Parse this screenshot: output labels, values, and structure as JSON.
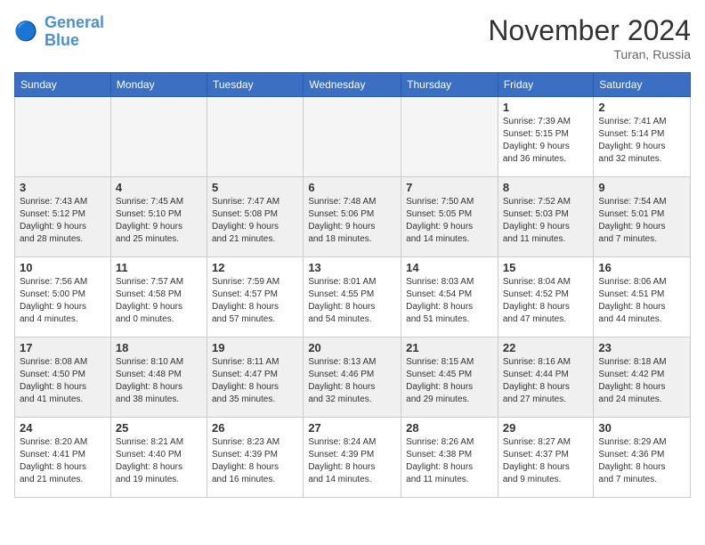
{
  "header": {
    "logo_line1": "General",
    "logo_line2": "Blue",
    "month": "November 2024",
    "location": "Turan, Russia"
  },
  "days_of_week": [
    "Sunday",
    "Monday",
    "Tuesday",
    "Wednesday",
    "Thursday",
    "Friday",
    "Saturday"
  ],
  "weeks": [
    {
      "row_class": "row-1",
      "days": [
        {
          "num": "",
          "info": "",
          "empty": true
        },
        {
          "num": "",
          "info": "",
          "empty": true
        },
        {
          "num": "",
          "info": "",
          "empty": true
        },
        {
          "num": "",
          "info": "",
          "empty": true
        },
        {
          "num": "",
          "info": "",
          "empty": true
        },
        {
          "num": "1",
          "info": "Sunrise: 7:39 AM\nSunset: 5:15 PM\nDaylight: 9 hours\nand 36 minutes.",
          "empty": false
        },
        {
          "num": "2",
          "info": "Sunrise: 7:41 AM\nSunset: 5:14 PM\nDaylight: 9 hours\nand 32 minutes.",
          "empty": false
        }
      ]
    },
    {
      "row_class": "row-2",
      "days": [
        {
          "num": "3",
          "info": "Sunrise: 7:43 AM\nSunset: 5:12 PM\nDaylight: 9 hours\nand 28 minutes.",
          "empty": false
        },
        {
          "num": "4",
          "info": "Sunrise: 7:45 AM\nSunset: 5:10 PM\nDaylight: 9 hours\nand 25 minutes.",
          "empty": false
        },
        {
          "num": "5",
          "info": "Sunrise: 7:47 AM\nSunset: 5:08 PM\nDaylight: 9 hours\nand 21 minutes.",
          "empty": false
        },
        {
          "num": "6",
          "info": "Sunrise: 7:48 AM\nSunset: 5:06 PM\nDaylight: 9 hours\nand 18 minutes.",
          "empty": false
        },
        {
          "num": "7",
          "info": "Sunrise: 7:50 AM\nSunset: 5:05 PM\nDaylight: 9 hours\nand 14 minutes.",
          "empty": false
        },
        {
          "num": "8",
          "info": "Sunrise: 7:52 AM\nSunset: 5:03 PM\nDaylight: 9 hours\nand 11 minutes.",
          "empty": false
        },
        {
          "num": "9",
          "info": "Sunrise: 7:54 AM\nSunset: 5:01 PM\nDaylight: 9 hours\nand 7 minutes.",
          "empty": false
        }
      ]
    },
    {
      "row_class": "row-3",
      "days": [
        {
          "num": "10",
          "info": "Sunrise: 7:56 AM\nSunset: 5:00 PM\nDaylight: 9 hours\nand 4 minutes.",
          "empty": false
        },
        {
          "num": "11",
          "info": "Sunrise: 7:57 AM\nSunset: 4:58 PM\nDaylight: 9 hours\nand 0 minutes.",
          "empty": false
        },
        {
          "num": "12",
          "info": "Sunrise: 7:59 AM\nSunset: 4:57 PM\nDaylight: 8 hours\nand 57 minutes.",
          "empty": false
        },
        {
          "num": "13",
          "info": "Sunrise: 8:01 AM\nSunset: 4:55 PM\nDaylight: 8 hours\nand 54 minutes.",
          "empty": false
        },
        {
          "num": "14",
          "info": "Sunrise: 8:03 AM\nSunset: 4:54 PM\nDaylight: 8 hours\nand 51 minutes.",
          "empty": false
        },
        {
          "num": "15",
          "info": "Sunrise: 8:04 AM\nSunset: 4:52 PM\nDaylight: 8 hours\nand 47 minutes.",
          "empty": false
        },
        {
          "num": "16",
          "info": "Sunrise: 8:06 AM\nSunset: 4:51 PM\nDaylight: 8 hours\nand 44 minutes.",
          "empty": false
        }
      ]
    },
    {
      "row_class": "row-4",
      "days": [
        {
          "num": "17",
          "info": "Sunrise: 8:08 AM\nSunset: 4:50 PM\nDaylight: 8 hours\nand 41 minutes.",
          "empty": false
        },
        {
          "num": "18",
          "info": "Sunrise: 8:10 AM\nSunset: 4:48 PM\nDaylight: 8 hours\nand 38 minutes.",
          "empty": false
        },
        {
          "num": "19",
          "info": "Sunrise: 8:11 AM\nSunset: 4:47 PM\nDaylight: 8 hours\nand 35 minutes.",
          "empty": false
        },
        {
          "num": "20",
          "info": "Sunrise: 8:13 AM\nSunset: 4:46 PM\nDaylight: 8 hours\nand 32 minutes.",
          "empty": false
        },
        {
          "num": "21",
          "info": "Sunrise: 8:15 AM\nSunset: 4:45 PM\nDaylight: 8 hours\nand 29 minutes.",
          "empty": false
        },
        {
          "num": "22",
          "info": "Sunrise: 8:16 AM\nSunset: 4:44 PM\nDaylight: 8 hours\nand 27 minutes.",
          "empty": false
        },
        {
          "num": "23",
          "info": "Sunrise: 8:18 AM\nSunset: 4:42 PM\nDaylight: 8 hours\nand 24 minutes.",
          "empty": false
        }
      ]
    },
    {
      "row_class": "row-5",
      "days": [
        {
          "num": "24",
          "info": "Sunrise: 8:20 AM\nSunset: 4:41 PM\nDaylight: 8 hours\nand 21 minutes.",
          "empty": false
        },
        {
          "num": "25",
          "info": "Sunrise: 8:21 AM\nSunset: 4:40 PM\nDaylight: 8 hours\nand 19 minutes.",
          "empty": false
        },
        {
          "num": "26",
          "info": "Sunrise: 8:23 AM\nSunset: 4:39 PM\nDaylight: 8 hours\nand 16 minutes.",
          "empty": false
        },
        {
          "num": "27",
          "info": "Sunrise: 8:24 AM\nSunset: 4:39 PM\nDaylight: 8 hours\nand 14 minutes.",
          "empty": false
        },
        {
          "num": "28",
          "info": "Sunrise: 8:26 AM\nSunset: 4:38 PM\nDaylight: 8 hours\nand 11 minutes.",
          "empty": false
        },
        {
          "num": "29",
          "info": "Sunrise: 8:27 AM\nSunset: 4:37 PM\nDaylight: 8 hours\nand 9 minutes.",
          "empty": false
        },
        {
          "num": "30",
          "info": "Sunrise: 8:29 AM\nSunset: 4:36 PM\nDaylight: 8 hours\nand 7 minutes.",
          "empty": false
        }
      ]
    }
  ]
}
